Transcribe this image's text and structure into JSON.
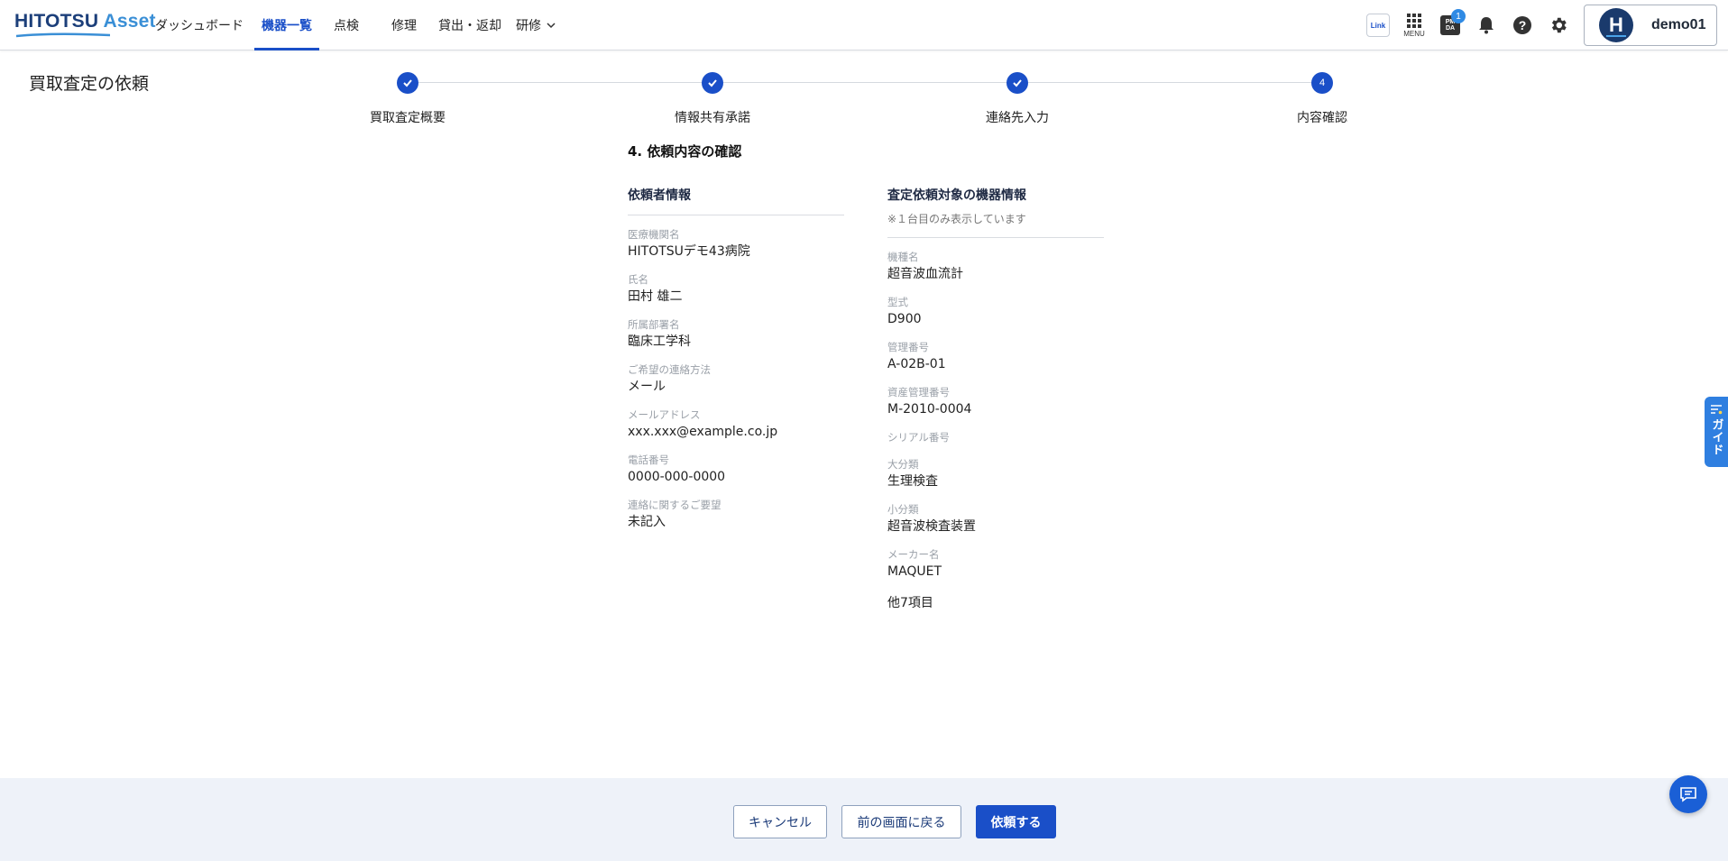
{
  "header": {
    "logo": "HITOTSU Asset",
    "nav": [
      {
        "label": "ダッシュボード"
      },
      {
        "label": "機器一覧",
        "active": true
      },
      {
        "label": "点検"
      },
      {
        "label": "修理"
      },
      {
        "label": "貸出・返却"
      },
      {
        "label": "研修"
      }
    ],
    "link_icon_text": "Link",
    "menu_label": "MENU",
    "pmda_icon_text": "PM DA",
    "pmda_badge": "1",
    "user": {
      "initial": "H",
      "name": "demo01"
    }
  },
  "page": {
    "title": "買取査定の依頼",
    "steps": [
      {
        "label": "買取査定概要",
        "state": "done"
      },
      {
        "label": "情報共有承諾",
        "state": "done"
      },
      {
        "label": "連絡先入力",
        "state": "done"
      },
      {
        "label": "内容確認",
        "state": "current",
        "number": "4"
      }
    ],
    "section_title": "4. 依頼内容の確認",
    "requester": {
      "heading": "依頼者情報",
      "fields": [
        {
          "label": "医療機関名",
          "value": "HITOTSUデモ43病院"
        },
        {
          "label": "氏名",
          "value": "田村 雄二"
        },
        {
          "label": "所属部署名",
          "value": "臨床工学科"
        },
        {
          "label": "ご希望の連絡方法",
          "value": "メール"
        },
        {
          "label": "メールアドレス",
          "value": "xxx.xxx@example.co.jp"
        },
        {
          "label": "電話番号",
          "value": "0000-000-0000"
        },
        {
          "label": "連絡に関するご要望",
          "value": "未記入"
        }
      ]
    },
    "device": {
      "heading": "査定依頼対象の機器情報",
      "note": "※１台目のみ表示しています",
      "fields": [
        {
          "label": "機種名",
          "value": "超音波血流計"
        },
        {
          "label": "型式",
          "value": "D900"
        },
        {
          "label": "管理番号",
          "value": "A-02B-01"
        },
        {
          "label": "資産管理番号",
          "value": "M-2010-0004"
        },
        {
          "label": "シリアル番号",
          "value": ""
        },
        {
          "label": "大分類",
          "value": "生理検査"
        },
        {
          "label": "小分類",
          "value": "超音波検査装置"
        },
        {
          "label": "メーカー名",
          "value": "MAQUET"
        }
      ],
      "more": "他7項目"
    }
  },
  "footer": {
    "cancel": "キャンセル",
    "back": "前の画面に戻る",
    "submit": "依頼する"
  },
  "guide_label": "ガイド",
  "colors": {
    "primary": "#1a4fc8",
    "footer_bg": "#eef2f9",
    "guide": "#2f7fe0"
  }
}
